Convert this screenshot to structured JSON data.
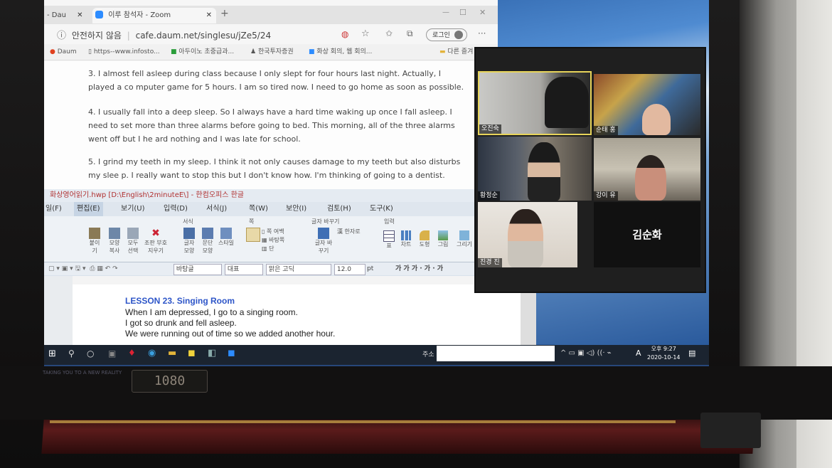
{
  "browser": {
    "tabs": [
      {
        "label": "- Dau"
      },
      {
        "label": "이루 참석자 - Zoom"
      }
    ],
    "security_label": "안전하지 않음",
    "url": "cafe.daum.net/singlesu/jZe5/24",
    "login_label": "로그인",
    "bookmarks": [
      "Daum",
      "https--www.infosto...",
      "아두이노 초중급과...",
      "한국투자증권",
      "화상 회의, 웹 회의...",
      "다른 즐겨"
    ]
  },
  "article": {
    "paragraphs": [
      "3. I almost fell asleep during class because I only slept for four hours last night. Actually, I played a co mputer game for 5 hours. I am so tired now. I need to go home as soon as possible.",
      "4. I usually fall into a deep sleep. So I always have a hard time waking up once I fall asleep. I need to set more than three alarms before going to bed. This morning, all of the three alarms went off but I he ard nothing and I was late for school.",
      "5. I grind my teeth in my sleep. I think it not only causes damage to my teeth but also disturbs my slee p. I really want to stop this but I don't know how. I'm thinking of going to a dentist."
    ]
  },
  "hwp": {
    "title": "화상영어읽기.hwp [D:\\English\\2minuteE\\] - 한컴오피스 한글",
    "menu": [
      "일(F)",
      "편집(E)",
      "보기(U)",
      "입력(D)",
      "서식(J)",
      "쪽(W)",
      "보안(I)",
      "검토(H)",
      "도구(K)"
    ],
    "ribbon_groups": [
      "서식",
      "쪽",
      "글자 바꾸기",
      "입력"
    ],
    "ribbon_buttons": [
      "붙이기",
      "모양 복사",
      "모두 선택",
      "조판 부호 지우기",
      "글자 모양",
      "문단 모양",
      "스타일",
      "쪽 여백",
      "바탕쪽",
      "단",
      "글자 바꾸기",
      "한자로",
      "표",
      "차트",
      "도형",
      "그림",
      "그리기"
    ],
    "toolbar": {
      "style": "바탕글",
      "font_type": "대표",
      "font": "맑은 고딕",
      "size": "12.0",
      "unit": "pt"
    },
    "lesson_title": "LESSON 23. Singing Room",
    "lines": [
      "When I am depressed, I go to a singing room.",
      "I got so drunk and fell asleep.",
      "We were running out of time so we added another hour."
    ]
  },
  "taskbar": {
    "address_label": "주소",
    "time": "오후 9:27",
    "date": "2020-10-14",
    "ime": "A"
  },
  "zoom": {
    "participants": [
      {
        "name": "오진숙"
      },
      {
        "name": "순태 홍"
      },
      {
        "name": "황정순"
      },
      {
        "name": "강이 유"
      },
      {
        "name": "진경 진"
      }
    ],
    "no_video_name": "김순화"
  },
  "laptop": {
    "bezel_text": "TAKING YOU TO A NEW REALITY",
    "badge": "1080"
  },
  "colors": {
    "lesson_title": "#2d55c8",
    "active_speaker": "#e7d45a",
    "keyboard_red": "#5b1b1b"
  }
}
